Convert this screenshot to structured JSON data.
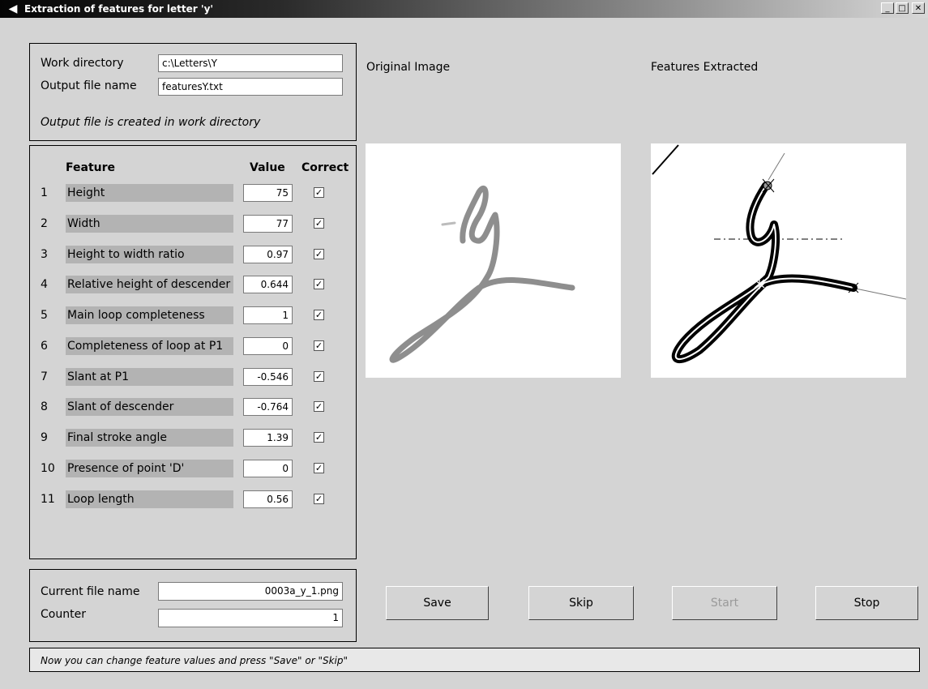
{
  "window": {
    "title": "Extraction of features for letter 'y'"
  },
  "settings": {
    "work_dir_label": "Work directory",
    "work_dir_value": "c:\\Letters\\Y",
    "output_label": "Output file name",
    "output_value": "featuresY.txt",
    "note": "Output file is created in work directory"
  },
  "features": {
    "header_feature": "Feature",
    "header_value": "Value",
    "header_correct": "Correct",
    "rows": [
      {
        "num": "1",
        "name": "Height",
        "value": "75",
        "correct": true
      },
      {
        "num": "2",
        "name": "Width",
        "value": "77",
        "correct": true
      },
      {
        "num": "3",
        "name": "Height to width ratio",
        "value": "0.97",
        "correct": true
      },
      {
        "num": "4",
        "name": "Relative height of descender",
        "value": "0.644",
        "correct": true
      },
      {
        "num": "5",
        "name": "Main loop completeness",
        "value": "1",
        "correct": true
      },
      {
        "num": "6",
        "name": "Completeness of loop at P1",
        "value": "0",
        "correct": true
      },
      {
        "num": "7",
        "name": "Slant at P1",
        "value": "-0.546",
        "correct": true
      },
      {
        "num": "8",
        "name": "Slant of descender",
        "value": "-0.764",
        "correct": true
      },
      {
        "num": "9",
        "name": "Final stroke angle",
        "value": "1.39",
        "correct": true
      },
      {
        "num": "10",
        "name": "Presence of point 'D'",
        "value": "0",
        "correct": true
      },
      {
        "num": "11",
        "name": "Loop length",
        "value": "0.56",
        "correct": true
      }
    ]
  },
  "images": {
    "original_label": "Original Image",
    "features_label": "Features Extracted"
  },
  "fileinfo": {
    "current_label": "Current file name",
    "current_value": "0003a_y_1.png",
    "counter_label": "Counter",
    "counter_value": "1"
  },
  "buttons": {
    "save": "Save",
    "skip": "Skip",
    "start": "Start",
    "stop": "Stop"
  },
  "status": {
    "message": "Now you can change feature values and press \"Save\" or \"Skip\""
  }
}
